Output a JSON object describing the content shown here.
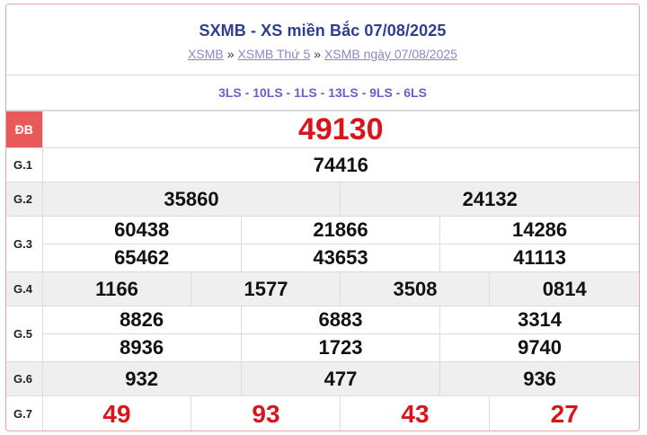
{
  "header": {
    "title": "SXMB - XS miền Bắc 07/08/2025",
    "crumbs": [
      "XSMB",
      "XSMB Thứ 5",
      "XSMB ngày 07/08/2025"
    ],
    "separator": "»"
  },
  "codes": "3LS - 10LS - 1LS - 13LS - 9LS - 6LS",
  "prizes": {
    "db": {
      "label": "ĐB",
      "numbers": [
        "49130"
      ]
    },
    "g1": {
      "label": "G.1",
      "numbers": [
        "74416"
      ]
    },
    "g2": {
      "label": "G.2",
      "numbers": [
        "35860",
        "24132"
      ]
    },
    "g3": {
      "label": "G.3",
      "numbers": [
        "60438",
        "21866",
        "14286",
        "65462",
        "43653",
        "41113"
      ]
    },
    "g4": {
      "label": "G.4",
      "numbers": [
        "1166",
        "1577",
        "3508",
        "0814"
      ]
    },
    "g5": {
      "label": "G.5",
      "numbers": [
        "8826",
        "6883",
        "3314",
        "8936",
        "1723",
        "9740"
      ]
    },
    "g6": {
      "label": "G.6",
      "numbers": [
        "932",
        "477",
        "936"
      ]
    },
    "g7": {
      "label": "G.7",
      "numbers": [
        "49",
        "93",
        "43",
        "27"
      ]
    }
  },
  "colors": {
    "title": "#2d3e93",
    "accent_red": "#d9141a",
    "db_badge": "#e85a5a",
    "codes": "#6a5fcc"
  }
}
